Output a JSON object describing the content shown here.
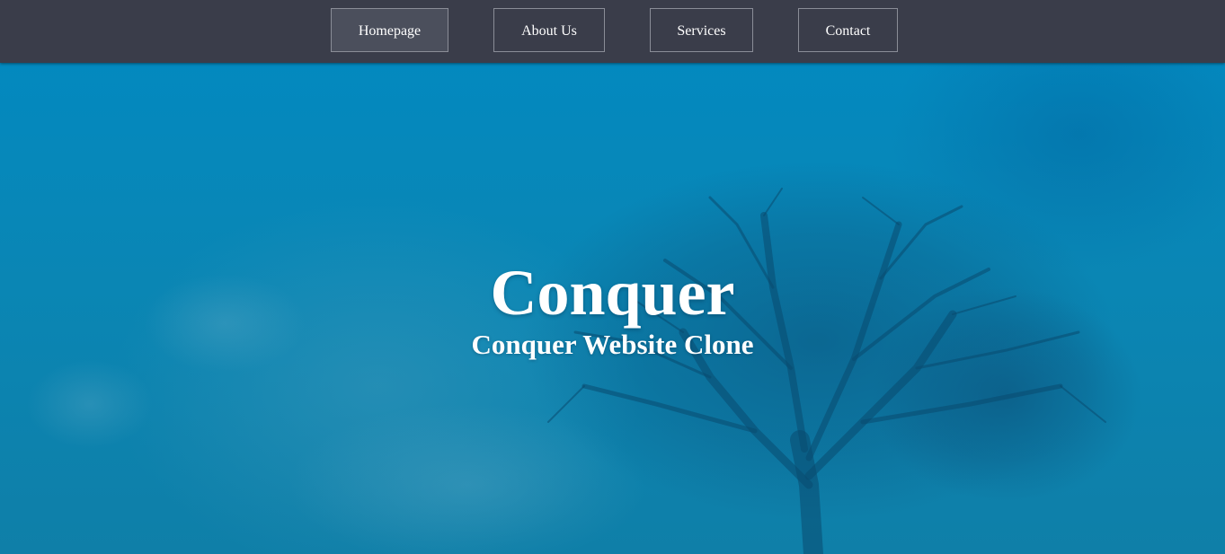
{
  "nav": {
    "items": [
      {
        "label": "Homepage",
        "active": true
      },
      {
        "label": "About Us",
        "active": false
      },
      {
        "label": "Services",
        "active": false
      },
      {
        "label": "Contact",
        "active": false
      }
    ]
  },
  "hero": {
    "title": "Conquer",
    "subtitle": "Conquer Website Clone",
    "background_image": "foggy-blue-tree"
  },
  "colors": {
    "navbar_bg": "#3a3d4a",
    "nav_active_bg": "#4b4f5c",
    "nav_border": "#8a8d97",
    "hero_blue": "#0a86b8",
    "text": "#ffffff"
  }
}
